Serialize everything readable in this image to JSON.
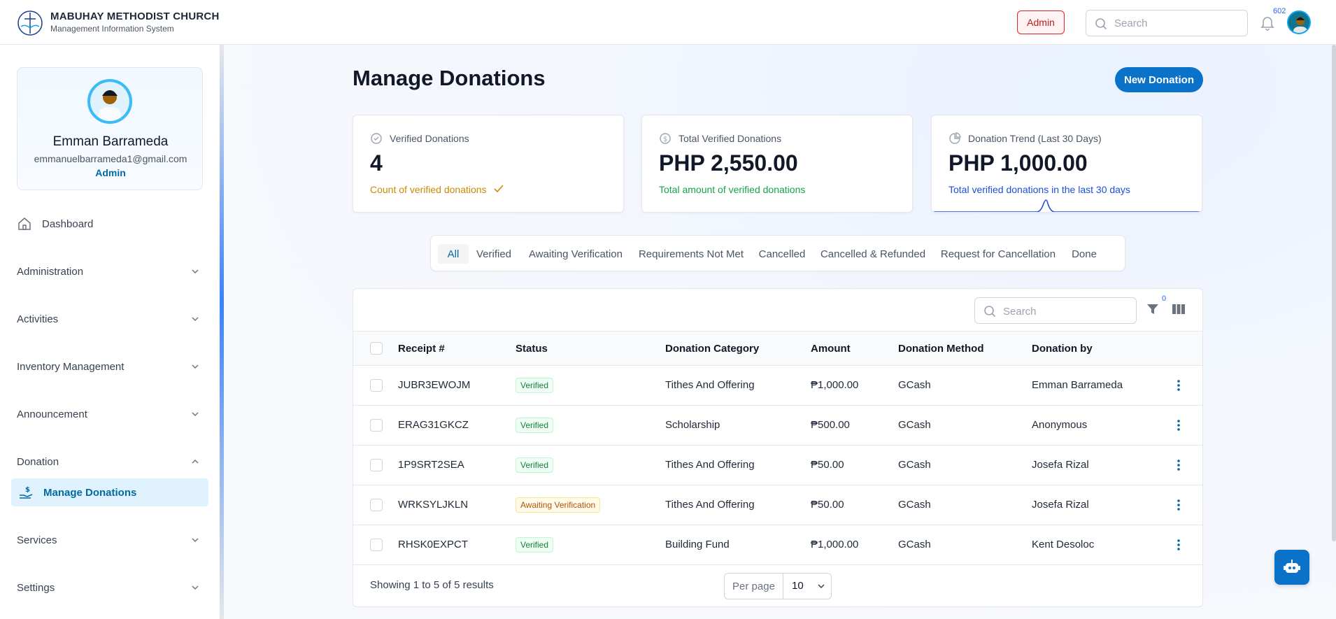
{
  "app": {
    "name": "MABUHAY METHODIST CHURCH",
    "subtitle": "Management Information System",
    "role_button": "Admin",
    "search_placeholder": "Search",
    "notification_count": "602"
  },
  "profile": {
    "name": "Emman Barrameda",
    "email": "emmanuelbarrameda1@gmail.com",
    "role": "Admin"
  },
  "sidebar": {
    "items": [
      {
        "label": "Dashboard"
      },
      {
        "label": "Administration"
      },
      {
        "label": "Activities"
      },
      {
        "label": "Inventory Management"
      },
      {
        "label": "Announcement"
      },
      {
        "label": "Donation"
      },
      {
        "label": "Services"
      },
      {
        "label": "Settings"
      }
    ],
    "active_sub": "Manage Donations"
  },
  "page": {
    "title": "Manage Donations",
    "new_button": "New Donation"
  },
  "stats": [
    {
      "title": "Verified Donations",
      "value": "4",
      "desc": "Count of verified donations"
    },
    {
      "title": "Total Verified Donations",
      "value": "PHP 2,550.00",
      "desc": "Total amount of verified donations"
    },
    {
      "title": "Donation Trend (Last 30 Days)",
      "value": "PHP 1,000.00",
      "desc": "Total verified donations in the last 30 days"
    }
  ],
  "tabs": [
    "All",
    "Verified",
    "Awaiting Verification",
    "Requirements Not Met",
    "Cancelled",
    "Cancelled & Refunded",
    "Request for Cancellation",
    "Done"
  ],
  "table": {
    "search_placeholder": "Search",
    "filter_count": "0",
    "columns": [
      "Receipt #",
      "Status",
      "Donation Category",
      "Amount",
      "Donation Method",
      "Donation by"
    ],
    "rows": [
      {
        "receipt": "JUBR3EWOJM",
        "status": "Verified",
        "category": "Tithes And Offering",
        "amount": "₱1,000.00",
        "method": "GCash",
        "by": "Emman Barrameda"
      },
      {
        "receipt": "ERAG31GKCZ",
        "status": "Verified",
        "category": "Scholarship",
        "amount": "₱500.00",
        "method": "GCash",
        "by": "Anonymous"
      },
      {
        "receipt": "1P9SRT2SEA",
        "status": "Verified",
        "category": "Tithes And Offering",
        "amount": "₱50.00",
        "method": "GCash",
        "by": "Josefa Rizal"
      },
      {
        "receipt": "WRKSYLJKLN",
        "status": "Awaiting Verification",
        "category": "Tithes And Offering",
        "amount": "₱50.00",
        "method": "GCash",
        "by": "Josefa Rizal"
      },
      {
        "receipt": "RHSK0EXPCT",
        "status": "Verified",
        "category": "Building Fund",
        "amount": "₱1,000.00",
        "method": "GCash",
        "by": "Kent Desoloc"
      }
    ],
    "footer": "Showing 1 to 5 of 5 results",
    "per_page_label": "Per page",
    "per_page_value": "10"
  },
  "colors": {
    "accent": "#0b72c9",
    "verified": "#15803d",
    "awaiting": "#b45309",
    "danger": "#b91c1c"
  }
}
